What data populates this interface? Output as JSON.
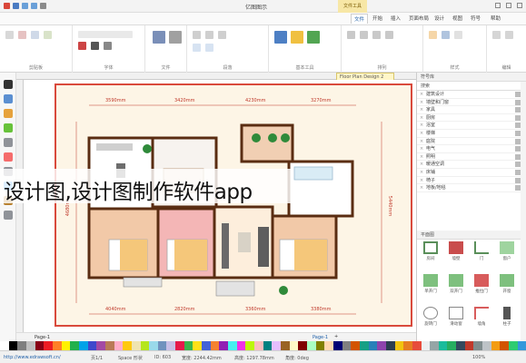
{
  "overlay": {
    "caption": "设计图,设计图制作软件app"
  },
  "titlebar": {
    "title": "亿图图示",
    "context_tab": "文件工具"
  },
  "ribbon_tabs": [
    {
      "label": "文件",
      "active": true
    },
    {
      "label": "开始"
    },
    {
      "label": "插入"
    },
    {
      "label": "页面布局"
    },
    {
      "label": "设计"
    },
    {
      "label": "视图"
    },
    {
      "label": "符号"
    },
    {
      "label": "帮助"
    }
  ],
  "ribbon": {
    "groups": [
      "剪贴板",
      "字体",
      "文件",
      "段落",
      "基本工具",
      "排列",
      "样式",
      "编辑"
    ]
  },
  "document_tab": "Floor Plan Design 2",
  "floorplan": {
    "dims_top": [
      "3590mm",
      "3420mm",
      "4230mm",
      "3270mm"
    ],
    "dims_bottom": [
      "4040mm",
      "2820mm",
      "3360mm",
      "3380mm"
    ],
    "dim_right": "5440mm",
    "dim_left": "4680mm"
  },
  "right_panel": {
    "header": "符号库",
    "search": "搜索",
    "library_items": [
      "建筑设计",
      "墙壁和门窗",
      "家具",
      "厨房",
      "浴室",
      "楼梯",
      "庭院",
      "电气",
      "照明",
      "暖通空调",
      "床铺",
      "椅子",
      "地板/地毯"
    ],
    "shapes_header": "平面图",
    "shapes": [
      "房间",
      "墙壁",
      "门",
      "窗户",
      "单开门",
      "双开门",
      "推拉门",
      "开窗",
      "旋转门",
      "滑动窗",
      "墙角",
      "柱子"
    ]
  },
  "page_tabs": {
    "current": "Page-1",
    "tab": "Page-1"
  },
  "statusbar": {
    "url": "http://www.edrawsoft.cn/",
    "page": "页1/1",
    "shape": "Space 形状",
    "coords": "ID: 603",
    "width": "宽度: 2244.42mm",
    "height": "高度: 1297.78mm",
    "angle": "角度: 0deg",
    "zoom": "100%"
  },
  "palette": [
    "#ffffff",
    "#000000",
    "#7f7f7f",
    "#c0c0c0",
    "#880015",
    "#ed1c24",
    "#ff7f27",
    "#fff200",
    "#22b14c",
    "#00a2e8",
    "#3f48cc",
    "#a349a4",
    "#b97a57",
    "#ffaec9",
    "#ffc90e",
    "#efe4b0",
    "#b5e61d",
    "#99d9ea",
    "#7092be",
    "#c8bfe7",
    "#e6194b",
    "#3cb44b",
    "#ffe119",
    "#4363d8",
    "#f58231",
    "#911eb4",
    "#46f0f0",
    "#f032e6",
    "#bcf60c",
    "#fabebe",
    "#008080",
    "#e6beff",
    "#9a6324",
    "#fffac8",
    "#800000",
    "#aaffc3",
    "#808000",
    "#ffd8b1",
    "#000075",
    "#808080",
    "#d35400",
    "#16a085",
    "#2980b9",
    "#8e44ad",
    "#2c3e50",
    "#f1c40f",
    "#e67e22",
    "#e74c3c",
    "#ecf0f1",
    "#95a5a6",
    "#1abc9c",
    "#27ae60",
    "#34495e",
    "#c0392b",
    "#7f8c8d",
    "#bdc3c7",
    "#f39c12",
    "#d35400",
    "#2ecc71",
    "#3498db"
  ]
}
